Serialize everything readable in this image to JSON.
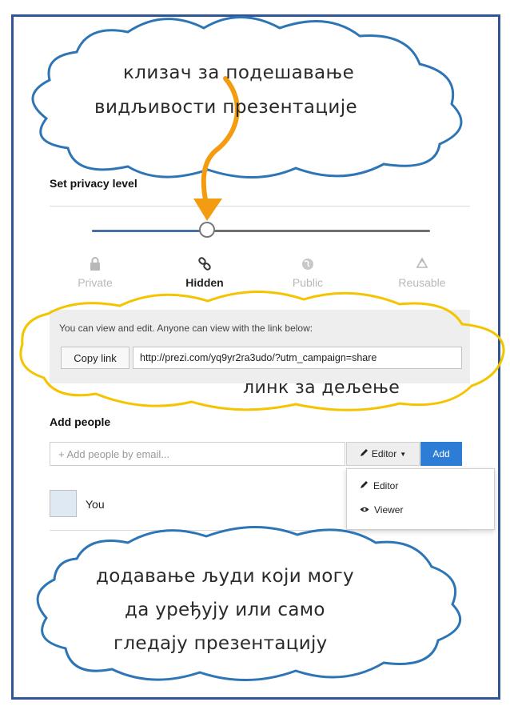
{
  "page": {
    "heading_initial": "S"
  },
  "privacy": {
    "heading": "Set privacy level",
    "slider_level": 0.34,
    "levels": [
      {
        "label": "Private",
        "icon": "lock-icon"
      },
      {
        "label": "Hidden",
        "icon": "link-icon"
      },
      {
        "label": "Public",
        "icon": "globe-icon"
      },
      {
        "label": "Reusable",
        "icon": "recycle-icon"
      }
    ],
    "selected": "Hidden"
  },
  "share": {
    "description": "You can view and edit. Anyone can view with the link below:",
    "copy_button": "Copy link",
    "link": "http://prezi.com/yq9yr2ra3udo/?utm_campaign=share"
  },
  "people": {
    "heading": "Add people",
    "email_placeholder": "+ Add people by email...",
    "role_button": "Editor",
    "add_button": "Add",
    "role_options": [
      {
        "label": "Editor",
        "icon": "pencil-icon"
      },
      {
        "label": "Viewer",
        "icon": "eye-icon"
      }
    ],
    "user": {
      "name": "You"
    }
  },
  "annotations": {
    "slider_callout_line1": "клизач за подешавање",
    "slider_callout_line2": "видљивости презентације",
    "link_callout": "линк за дељење",
    "people_callout_line1": "додавање људи који могу",
    "people_callout_line2": "да уређују или само",
    "people_callout_line3": "гледају презентацију"
  },
  "colors": {
    "frame": "#2f5597",
    "cloud_outline_blue": "#2e75b6",
    "cloud_outline_yellow": "#f5c400",
    "arrow": "#f39c12",
    "add_button": "#2d7cd6",
    "slider_fill": "#4a6fa5"
  }
}
